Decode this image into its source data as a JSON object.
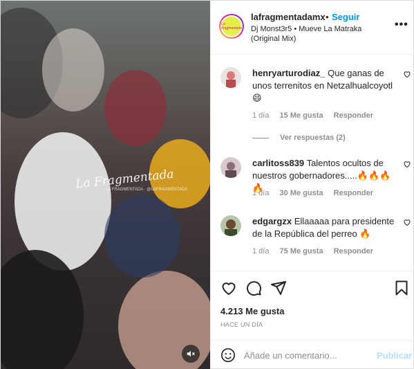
{
  "post": {
    "username": "lafragmentadamx",
    "separator": "•",
    "follow_label": "Seguir",
    "audio": "Dj Monst3r5 • Mueve La Matraka (Original Mix)",
    "avatar_text": "La Fragmentada",
    "more_icon": "more-horizontal-icon"
  },
  "media": {
    "watermark": "La Fragmentada",
    "watermark_sub": "LA FRAGMENTADA · @LAFRAGMENTADA",
    "mute_icon": "speaker-muted-icon"
  },
  "comments": [
    {
      "user": "henryarturodiaz_",
      "text": "Que ganas de unos terrenitos en Netzalhualcoyotl 😄",
      "time": "1 día",
      "likes": "15 Me gusta",
      "reply_label": "Responder",
      "avatar_color": "#d97a7a"
    },
    {
      "user": "carlitoss839",
      "text": "Talentos ocultos de nuestros gobernadores.....🔥🔥🔥🔥",
      "time": "1 día",
      "likes": "30 Me gusta",
      "reply_label": "Responder",
      "avatar_color": "#c7b1b8"
    },
    {
      "user": "edgargzx",
      "text": "Ellaaaaa para presidente de la República del perreo 🔥",
      "time": "1 día",
      "likes": "75 Me gusta",
      "reply_label": "Responder",
      "avatar_color": "#6f8a57"
    }
  ],
  "view_replies": "Ver respuestas (2)",
  "actions": {
    "like_icon": "heart-icon",
    "comment_icon": "comment-icon",
    "share_icon": "send-icon",
    "save_icon": "bookmark-icon"
  },
  "likes_count": "4.213 Me gusta",
  "posted_ago": "HACE UN DÍA",
  "composer": {
    "placeholder": "Añade un comentario...",
    "publish_label": "Publicar",
    "emoji_icon": "emoji-icon"
  },
  "colors": {
    "accent": "#0095f6",
    "publish_disabled": "#b2dffc",
    "muted_text": "#8e8e8e"
  }
}
